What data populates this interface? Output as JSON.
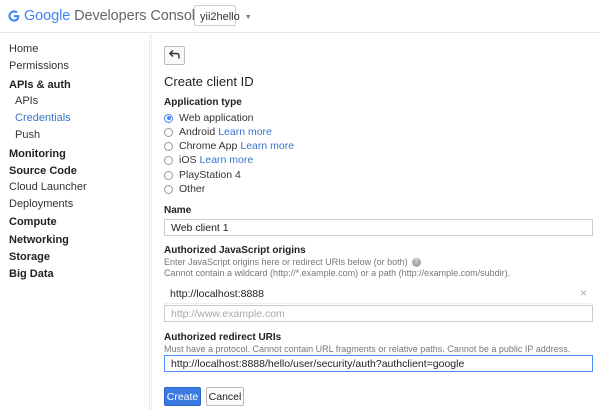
{
  "header": {
    "logo_google": "Google",
    "logo_rest": "Developers Console",
    "project": "yii2hello"
  },
  "sidebar": {
    "items": [
      {
        "label": "Home"
      },
      {
        "label": "Permissions"
      },
      {
        "label": "APIs & auth"
      },
      {
        "label": "APIs"
      },
      {
        "label": "Credentials"
      },
      {
        "label": "Push"
      },
      {
        "label": "Monitoring"
      },
      {
        "label": "Source Code"
      },
      {
        "label": "Cloud Launcher"
      },
      {
        "label": "Deployments"
      },
      {
        "label": "Compute"
      },
      {
        "label": "Networking"
      },
      {
        "label": "Storage"
      },
      {
        "label": "Big Data"
      }
    ]
  },
  "form": {
    "title": "Create client ID",
    "app_type_label": "Application type",
    "app_types": [
      {
        "label": "Web application",
        "link": "",
        "checked": true
      },
      {
        "label": "Android",
        "link": "Learn more",
        "checked": false
      },
      {
        "label": "Chrome App",
        "link": "Learn more",
        "checked": false
      },
      {
        "label": "iOS",
        "link": "Learn more",
        "checked": false
      },
      {
        "label": "PlayStation 4",
        "link": "",
        "checked": false
      },
      {
        "label": "Other",
        "link": "",
        "checked": false
      }
    ],
    "name_label": "Name",
    "name_value": "Web client 1",
    "origins_label": "Authorized JavaScript origins",
    "origins_hint1": "Enter JavaScript origins here or redirect URIs below (or both)",
    "origins_hint2": "Cannot contain a wildcard (http://*.example.com) or a path (http://example.com/subdir).",
    "origin_value": "http://localhost:8888",
    "origin_placeholder": "http://www.example.com",
    "redirect_label": "Authorized redirect URIs",
    "redirect_hint": "Must have a protocol. Cannot contain URL fragments or relative paths. Cannot be a public IP address.",
    "redirect_value": "http://localhost:8888/hello/user/security/auth?authclient=google",
    "create_label": "Create",
    "cancel_label": "Cancel"
  },
  "colors": {
    "accent": "#4285f4",
    "link": "#3a73c8",
    "primary_button": "#3b7ae0"
  }
}
